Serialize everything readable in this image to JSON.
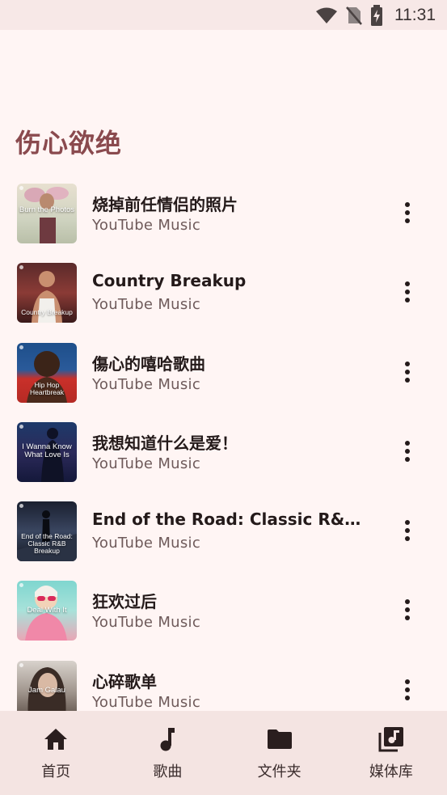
{
  "status_bar": {
    "time": "11:31"
  },
  "page": {
    "title": "伤心欲绝"
  },
  "tracks": [
    {
      "title": "烧掉前任情侣的照片",
      "subtitle": "YouTube Music",
      "cover_text": "Burn the Photos"
    },
    {
      "title": "Country Breakup",
      "subtitle": "YouTube Music",
      "cover_text": "Country Breakup"
    },
    {
      "title": "傷心的嘻哈歌曲",
      "subtitle": "YouTube Music",
      "cover_text": "Hip Hop Heartbreak"
    },
    {
      "title": "我想知道什么是爱！",
      "subtitle": "YouTube Music",
      "cover_text": "I Wanna Know What Love Is"
    },
    {
      "title": "End of the Road: Classic R&B Breakup",
      "subtitle": "YouTube Music",
      "cover_text": "End of the Road: Classic R&B Breakup"
    },
    {
      "title": "狂欢过后",
      "subtitle": "YouTube Music",
      "cover_text": "Deal With It"
    },
    {
      "title": "心碎歌单",
      "subtitle": "YouTube Music",
      "cover_text": "Jam Galau"
    }
  ],
  "bottom_nav": {
    "items": [
      {
        "label": "首页",
        "icon": "home-icon"
      },
      {
        "label": "歌曲",
        "icon": "music-note-icon"
      },
      {
        "label": "文件夹",
        "icon": "folder-icon"
      },
      {
        "label": "媒体库",
        "icon": "library-music-icon"
      }
    ]
  },
  "colors": {
    "background": "#fff5f4",
    "title_accent": "#8a4a4e",
    "nav_background": "#f4e4e2",
    "status_bar": "#f7e8e7"
  }
}
